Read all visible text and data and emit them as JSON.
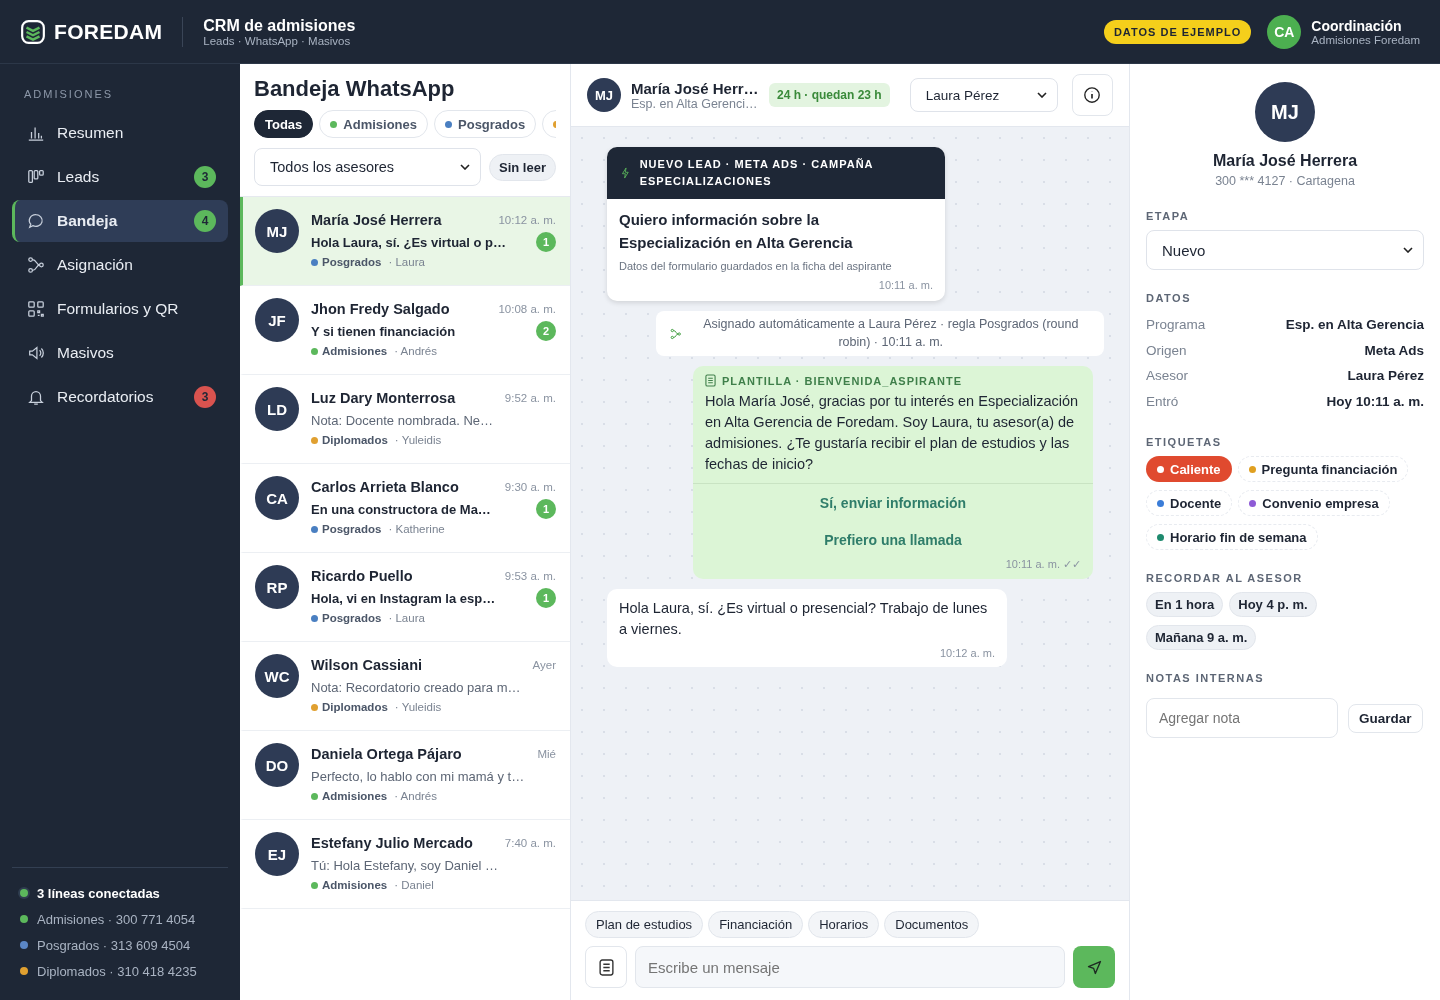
{
  "header": {
    "brand": "FOREDAM",
    "title": "CRM de admisiones",
    "subtitle": "Leads · WhatsApp · Masivos",
    "demo_badge": "DATOS DE EJEMPLO",
    "user": {
      "initials": "CA",
      "name": "Coordinación",
      "role": "Admisiones Foredam"
    }
  },
  "sidebar": {
    "section": "ADMISIONES",
    "items": [
      {
        "label": "Resumen",
        "selected": false
      },
      {
        "label": "Leads",
        "badge": "3",
        "color": "#5cb85c",
        "selected": false
      },
      {
        "label": "Bandeja",
        "badge": "4",
        "color": "#5cb85c",
        "selected": true
      },
      {
        "label": "Asignación",
        "selected": false
      },
      {
        "label": "Formularios y QR",
        "selected": false
      },
      {
        "label": "Masivos",
        "selected": false
      },
      {
        "label": "Recordatorios",
        "badge": "3",
        "color": "#d9534f",
        "selected": false
      }
    ],
    "status": {
      "label": "3 líneas conectadas",
      "lines": [
        {
          "text": "Admisiones · 300 771 4054",
          "color": "#5cb85c"
        },
        {
          "text": "Posgrados · 313 609 4504",
          "color": "#5b86c5"
        },
        {
          "text": "Diplomados · 310 418 4235",
          "color": "#e0a030"
        }
      ]
    }
  },
  "inbox": {
    "title": "Bandeja WhatsApp",
    "filters": [
      {
        "label": "Todas",
        "selected": true
      },
      {
        "label": "Admisiones",
        "color": "#5cb85c",
        "selected": false
      },
      {
        "label": "Posgrados",
        "color": "#4a7fc1",
        "selected": false
      },
      {
        "color": "#e0a030",
        "selected": false
      }
    ],
    "advisor_select": "Todos los asesores",
    "unread_button": "Sin leer",
    "conversations": [
      {
        "initials": "MJ",
        "name": "María José Herrera",
        "time": "10:12 a. m.",
        "preview": "Hola Laura, sí. ¿Es virtual o p…",
        "unread": "1",
        "program": "Posgrados",
        "color": "#4a7fc1",
        "advisor": "· Laura",
        "selected": true
      },
      {
        "initials": "JF",
        "name": "Jhon Fredy Salgado",
        "time": "10:08 a. m.",
        "preview": "Y si tienen financiación",
        "unread": "2",
        "program": "Admisiones",
        "color": "#5cb85c",
        "advisor": "· Andrés",
        "selected": false
      },
      {
        "initials": "LD",
        "name": "Luz Dary Monterrosa",
        "time": "9:52 a. m.",
        "preview": "Nota: Docente nombrada. Ne…",
        "program": "Diplomados",
        "color": "#e0a030",
        "advisor": "· Yuleidis",
        "selected": false
      },
      {
        "initials": "CA",
        "name": "Carlos Arrieta Blanco",
        "time": "9:30 a. m.",
        "preview": "En una constructora de Ma…",
        "unread": "1",
        "program": "Posgrados",
        "color": "#4a7fc1",
        "advisor": "· Katherine",
        "selected": false
      },
      {
        "initials": "RP",
        "name": "Ricardo Puello",
        "time": "9:53 a. m.",
        "preview": "Hola, vi en Instagram la esp…",
        "unread": "1",
        "program": "Posgrados",
        "color": "#4a7fc1",
        "advisor": "· Laura",
        "selected": false
      },
      {
        "initials": "WC",
        "name": "Wilson Cassiani",
        "time": "Ayer",
        "preview": "Nota: Recordatorio creado para m…",
        "program": "Diplomados",
        "color": "#e0a030",
        "advisor": "· Yuleidis",
        "selected": false
      },
      {
        "initials": "DO",
        "name": "Daniela Ortega Pájaro",
        "time": "Mié",
        "preview": "Perfecto, lo hablo con mi mamá y t…",
        "program": "Admisiones",
        "color": "#5cb85c",
        "advisor": "· Andrés",
        "selected": false
      },
      {
        "initials": "EJ",
        "name": "Estefany Julio Mercado",
        "time": "7:40 a. m.",
        "preview": "Tú: Hola Estefany, soy Daniel …",
        "program": "Admisiones",
        "color": "#5cb85c",
        "advisor": "· Daniel",
        "selected": false
      }
    ]
  },
  "chat": {
    "initials": "MJ",
    "name": "María José Herr…",
    "subtitle": "Esp. en Alta Gerenci…",
    "window_badge": "24 h · quedan 23 h",
    "advisor_select": "Laura Pérez",
    "messages": [
      {
        "kind": "lead",
        "header": "NUEVO LEAD · META ADS · CAMPAÑA ESPECIALIZACIONES",
        "title": "Quiero información sobre la Especialización en Alta Gerencia",
        "note": "Datos del formulario guardados en la ficha del aspirante",
        "time": "10:11 a. m."
      },
      {
        "kind": "system",
        "text": "Asignado automáticamente a Laura Pérez · regla Posgrados (round robin) · 10:11 a. m."
      },
      {
        "kind": "template",
        "header": "PLANTILLA · BIENVENIDA_ASPIRANTE",
        "text": "Hola María José, gracias por tu interés en Especialización en Alta Gerencia de Foredam. Soy Laura, tu asesor(a) de admisiones. ¿Te gustaría recibir el plan de estudios y las fechas de inicio?",
        "buttons": [
          "Sí, enviar información",
          "Prefiero una llamada"
        ],
        "time": "10:11 a. m. ✓✓"
      },
      {
        "kind": "incoming",
        "text": "Hola Laura, sí. ¿Es virtual o presencial? Trabajo de lunes a viernes.",
        "time": "10:12 a. m."
      }
    ],
    "quick_replies": [
      "Plan de estudios",
      "Financiación",
      "Horarios",
      "Documentos"
    ],
    "composer_placeholder": "Escribe un mensaje"
  },
  "profile": {
    "initials": "MJ",
    "name": "María José Herrera",
    "subtitle": "300 *** 4127 · Cartagena",
    "stage_label": "ETAPA",
    "stage": "Nuevo",
    "data_label": "DATOS",
    "fields": [
      {
        "label": "Programa",
        "value": "Esp. en Alta Gerencia"
      },
      {
        "label": "Origen",
        "value": "Meta Ads"
      },
      {
        "label": "Asesor",
        "value": "Laura Pérez"
      },
      {
        "label": "Entró",
        "value": "Hoy 10:11 a. m."
      }
    ],
    "tags_label": "ETIQUETAS",
    "tags": [
      {
        "label": "Caliente",
        "color": "#e04a2f",
        "selected": true
      },
      {
        "label": "Pregunta financiación",
        "color": "#e0a020",
        "selected": false
      },
      {
        "label": "Docente",
        "color": "#3b7dd8",
        "selected": false
      },
      {
        "label": "Convenio empresa",
        "color": "#8e5bd6",
        "selected": false
      },
      {
        "label": "Horario fin de semana",
        "color": "#1e8a6e",
        "selected": false
      }
    ],
    "reminder_label": "RECORDAR AL ASESOR",
    "reminders": [
      "En 1 hora",
      "Hoy 4 p. m.",
      "Mañana 9 a. m."
    ],
    "notes_label": "NOTAS INTERNAS",
    "note_placeholder": "Agregar nota",
    "save_button": "Guardar"
  }
}
